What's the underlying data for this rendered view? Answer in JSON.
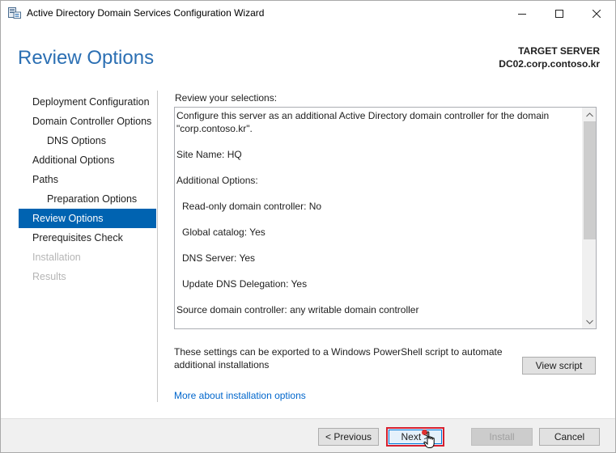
{
  "window": {
    "title": "Active Directory Domain Services Configuration Wizard",
    "controls": {
      "minimize": "minimize-icon",
      "maximize": "maximize-icon",
      "close": "close-icon"
    }
  },
  "header": {
    "page_title": "Review Options",
    "target_label": "TARGET SERVER",
    "target_name": "DC02.corp.contoso.kr"
  },
  "nav": {
    "items": [
      {
        "label": "Deployment Configuration"
      },
      {
        "label": "Domain Controller Options"
      },
      {
        "label": "DNS Options"
      },
      {
        "label": "Additional Options"
      },
      {
        "label": "Paths"
      },
      {
        "label": "Preparation Options"
      },
      {
        "label": "Review Options"
      },
      {
        "label": "Prerequisites Check"
      },
      {
        "label": "Installation"
      },
      {
        "label": "Results"
      }
    ]
  },
  "content": {
    "review_label": "Review your selections:",
    "lines": [
      "Configure this server as an additional Active Directory domain controller for the domain \"corp.contoso.kr\".",
      "Site Name: HQ",
      "Additional Options:",
      "Read-only domain controller: No",
      "Global catalog: Yes",
      "DNS Server: Yes",
      "Update DNS Delegation: Yes",
      "Source domain controller: any writable domain controller"
    ],
    "export_text": "These settings can be exported to a Windows PowerShell script to automate additional installations",
    "view_script": "View script",
    "more_link": "More about installation options"
  },
  "footer": {
    "previous": "< Previous",
    "next": "Next >",
    "install": "Install",
    "cancel": "Cancel"
  },
  "colors": {
    "accent": "#0063b1",
    "title_blue": "#2b6fb3",
    "link": "#0066cc",
    "highlight_border": "#d6202f"
  }
}
